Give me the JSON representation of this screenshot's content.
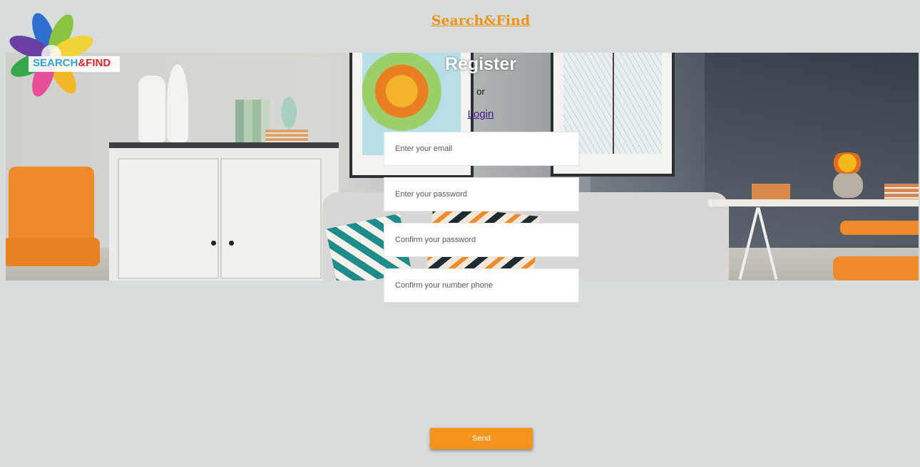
{
  "header": {
    "site_title": "Search&Find"
  },
  "logo": {
    "text_search": "SEARCH",
    "text_amp_find": "&FIND"
  },
  "form": {
    "title": "Register",
    "or_text": "or",
    "login_link": "Login",
    "email_placeholder": "Enter your email",
    "password_placeholder": "Enter your password",
    "confirm_password_placeholder": "Confirm your password",
    "phone_placeholder": "Confirm your number phone",
    "send_label": "Send"
  },
  "colors": {
    "accent": "#f7941d",
    "title": "#f39114",
    "background": "#d7dcdc"
  }
}
